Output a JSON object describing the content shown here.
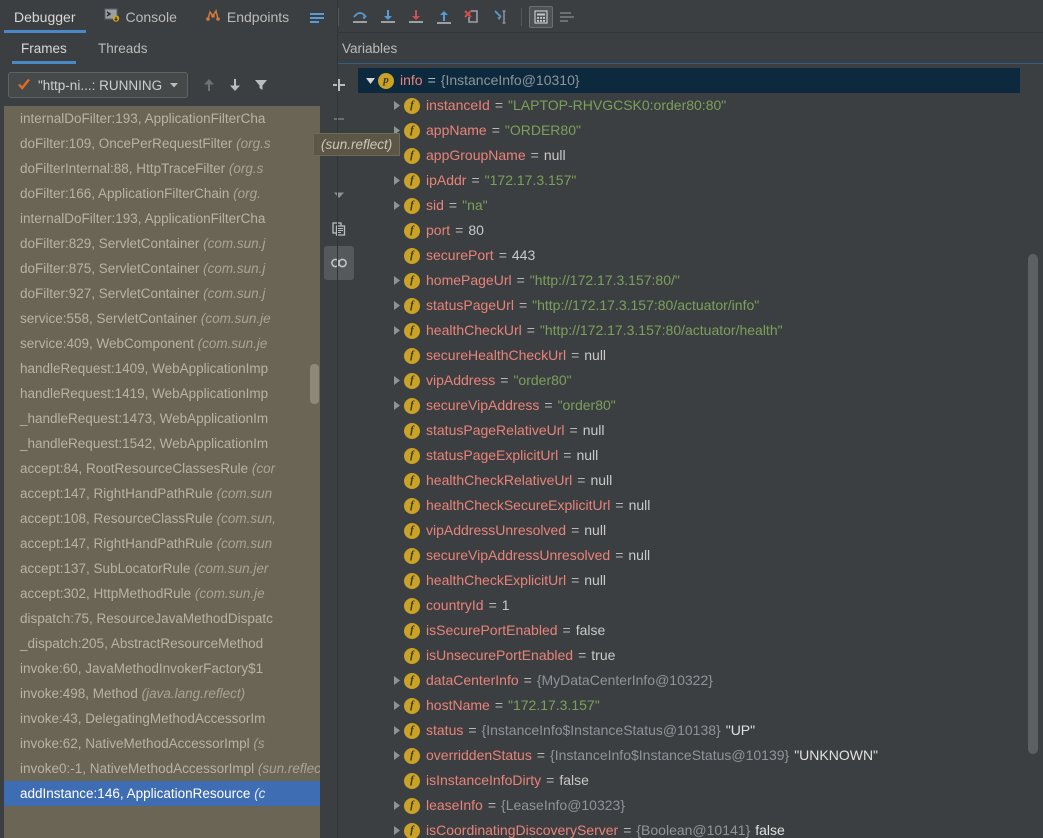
{
  "window": {
    "title": "Debugger",
    "bg_color": "#3c3f41",
    "accent_color": "#4a88c7"
  },
  "top_tabs": [
    {
      "label": "Debugger",
      "icon": "bug-icon",
      "active": true
    },
    {
      "label": "Console",
      "icon": "console-icon",
      "active": false
    },
    {
      "label": "Endpoints",
      "icon": "endpoints-icon",
      "active": false
    }
  ],
  "toolbar_icons": [
    {
      "name": "layout-lines-icon",
      "tooltip": "Layout"
    },
    {
      "name": "step-over-icon",
      "tooltip": "Step Over"
    },
    {
      "name": "step-into-icon",
      "tooltip": "Step Into"
    },
    {
      "name": "force-step-into-icon",
      "tooltip": "Force Step Into"
    },
    {
      "name": "step-out-icon",
      "tooltip": "Step Out"
    },
    {
      "name": "drop-frame-icon",
      "tooltip": "Drop Frame"
    },
    {
      "name": "run-to-cursor-icon",
      "tooltip": "Run to Cursor"
    },
    {
      "name": "evaluate-expression-icon",
      "tooltip": "Evaluate Expression"
    },
    {
      "name": "settings-lines-icon",
      "tooltip": "Settings"
    }
  ],
  "sub_tabs": [
    {
      "label": "Frames",
      "active": true
    },
    {
      "label": "Threads",
      "active": false
    }
  ],
  "variables_header": {
    "label": "Variables"
  },
  "frames_toolbar": {
    "thread_selector": {
      "label": "\"http-ni...: RUNNING",
      "status_icon": "check-icon",
      "chevron": "chevron-down-icon"
    },
    "buttons": [
      {
        "name": "move-up-icon",
        "label": "Up"
      },
      {
        "name": "move-down-icon",
        "label": "Down"
      },
      {
        "name": "filter-icon",
        "label": "Filter"
      }
    ]
  },
  "mid_toolbar": [
    {
      "name": "add-watch-icon",
      "glyph": "+",
      "pressed": false
    },
    {
      "name": "remove-watch-icon",
      "glyph": "–",
      "pressed": false
    },
    {
      "name": "dropdown-icon",
      "glyph": "chevron-down",
      "pressed": false
    },
    {
      "name": "copy-icon",
      "glyph": "copy",
      "pressed": false
    },
    {
      "name": "watches-icon",
      "glyph": "watches",
      "pressed": true
    }
  ],
  "frames": [
    {
      "method": "addInstance:146, ApplicationResource",
      "pkg": "(c",
      "selected": true
    },
    {
      "method": "invoke0:-1, NativeMethodAccessorImpl",
      "pkg": "(sun.reflect)",
      "selected": false
    },
    {
      "method": "invoke:62, NativeMethodAccessorImpl",
      "pkg": "(s",
      "selected": false
    },
    {
      "method": "invoke:43, DelegatingMethodAccessorIm",
      "pkg": "",
      "selected": false
    },
    {
      "method": "invoke:498, Method",
      "pkg": "(java.lang.reflect)",
      "selected": false
    },
    {
      "method": "invoke:60, JavaMethodInvokerFactory$1",
      "pkg": "",
      "selected": false
    },
    {
      "method": "_dispatch:205, AbstractResourceMethod",
      "pkg": "",
      "selected": false
    },
    {
      "method": "dispatch:75, ResourceJavaMethodDispatc",
      "pkg": "",
      "selected": false
    },
    {
      "method": "accept:302, HttpMethodRule",
      "pkg": "(com.sun.je",
      "selected": false
    },
    {
      "method": "accept:137, SubLocatorRule",
      "pkg": "(com.sun.jer",
      "selected": false
    },
    {
      "method": "accept:147, RightHandPathRule",
      "pkg": "(com.sun",
      "selected": false
    },
    {
      "method": "accept:108, ResourceClassRule",
      "pkg": "(com.sun,",
      "selected": false
    },
    {
      "method": "accept:147, RightHandPathRule",
      "pkg": "(com.sun",
      "selected": false
    },
    {
      "method": "accept:84, RootResourceClassesRule",
      "pkg": "(cor",
      "selected": false
    },
    {
      "method": "_handleRequest:1542, WebApplicationIm",
      "pkg": "",
      "selected": false
    },
    {
      "method": "_handleRequest:1473, WebApplicationIm",
      "pkg": "",
      "selected": false
    },
    {
      "method": "handleRequest:1419, WebApplicationImp",
      "pkg": "",
      "selected": false
    },
    {
      "method": "handleRequest:1409, WebApplicationImp",
      "pkg": "",
      "selected": false
    },
    {
      "method": "service:409, WebComponent",
      "pkg": "(com.sun.je",
      "selected": false
    },
    {
      "method": "service:558, ServletContainer",
      "pkg": "(com.sun.je",
      "selected": false
    },
    {
      "method": "doFilter:927, ServletContainer",
      "pkg": "(com.sun.j",
      "selected": false
    },
    {
      "method": "doFilter:875, ServletContainer",
      "pkg": "(com.sun.j",
      "selected": false
    },
    {
      "method": "doFilter:829, ServletContainer",
      "pkg": "(com.sun.j",
      "selected": false
    },
    {
      "method": "internalDoFilter:193, ApplicationFilterCha",
      "pkg": "",
      "selected": false
    },
    {
      "method": "doFilter:166, ApplicationFilterChain",
      "pkg": "(org.",
      "selected": false
    },
    {
      "method": "doFilterInternal:88, HttpTraceFilter",
      "pkg": "(org.s",
      "selected": false
    },
    {
      "method": "doFilter:109, OncePerRequestFilter",
      "pkg": "(org.s",
      "selected": false
    },
    {
      "method": "internalDoFilter:193, ApplicationFilterCha",
      "pkg": "",
      "selected": false
    }
  ],
  "tooltip": {
    "text": "(sun.reflect)"
  },
  "variables": [
    {
      "indent": 0,
      "twisty": "expanded",
      "icon": "p",
      "name": "info",
      "op": "=",
      "value": "{InstanceInfo@10310}",
      "vtype": "ref",
      "selected": true
    },
    {
      "indent": 1,
      "twisty": "collapsed",
      "icon": "f",
      "name": "instanceId",
      "op": "=",
      "value": "\"LAPTOP-RHVGCSK0:order80:80\"",
      "vtype": "str",
      "selected": false
    },
    {
      "indent": 1,
      "twisty": "collapsed",
      "icon": "f",
      "name": "appName",
      "op": "=",
      "value": "\"ORDER80\"",
      "vtype": "str",
      "selected": false
    },
    {
      "indent": 1,
      "twisty": "none",
      "icon": "f",
      "name": "appGroupName",
      "op": "=",
      "value": "null",
      "vtype": "null",
      "selected": false
    },
    {
      "indent": 1,
      "twisty": "collapsed",
      "icon": "f",
      "name": "ipAddr",
      "op": "=",
      "value": "\"172.17.3.157\"",
      "vtype": "str",
      "selected": false
    },
    {
      "indent": 1,
      "twisty": "collapsed",
      "icon": "f",
      "name": "sid",
      "op": "=",
      "value": "\"na\"",
      "vtype": "str",
      "selected": false
    },
    {
      "indent": 1,
      "twisty": "none",
      "icon": "f",
      "name": "port",
      "op": "=",
      "value": "80",
      "vtype": "num",
      "selected": false
    },
    {
      "indent": 1,
      "twisty": "none",
      "icon": "f",
      "name": "securePort",
      "op": "=",
      "value": "443",
      "vtype": "num",
      "selected": false
    },
    {
      "indent": 1,
      "twisty": "collapsed",
      "icon": "f",
      "name": "homePageUrl",
      "op": "=",
      "value": "\"http://172.17.3.157:80/\"",
      "vtype": "str",
      "selected": false
    },
    {
      "indent": 1,
      "twisty": "collapsed",
      "icon": "f",
      "name": "statusPageUrl",
      "op": "=",
      "value": "\"http://172.17.3.157:80/actuator/info\"",
      "vtype": "str",
      "selected": false
    },
    {
      "indent": 1,
      "twisty": "collapsed",
      "icon": "f",
      "name": "healthCheckUrl",
      "op": "=",
      "value": "\"http://172.17.3.157:80/actuator/health\"",
      "vtype": "str",
      "selected": false
    },
    {
      "indent": 1,
      "twisty": "none",
      "icon": "f",
      "name": "secureHealthCheckUrl",
      "op": "=",
      "value": "null",
      "vtype": "null",
      "selected": false
    },
    {
      "indent": 1,
      "twisty": "collapsed",
      "icon": "f",
      "name": "vipAddress",
      "op": "=",
      "value": "\"order80\"",
      "vtype": "str",
      "selected": false
    },
    {
      "indent": 1,
      "twisty": "collapsed",
      "icon": "f",
      "name": "secureVipAddress",
      "op": "=",
      "value": "\"order80\"",
      "vtype": "str",
      "selected": false
    },
    {
      "indent": 1,
      "twisty": "none",
      "icon": "f",
      "name": "statusPageRelativeUrl",
      "op": "=",
      "value": "null",
      "vtype": "null",
      "selected": false
    },
    {
      "indent": 1,
      "twisty": "none",
      "icon": "f",
      "name": "statusPageExplicitUrl",
      "op": "=",
      "value": "null",
      "vtype": "null",
      "selected": false
    },
    {
      "indent": 1,
      "twisty": "none",
      "icon": "f",
      "name": "healthCheckRelativeUrl",
      "op": "=",
      "value": "null",
      "vtype": "null",
      "selected": false
    },
    {
      "indent": 1,
      "twisty": "none",
      "icon": "f",
      "name": "healthCheckSecureExplicitUrl",
      "op": "=",
      "value": "null",
      "vtype": "null",
      "selected": false
    },
    {
      "indent": 1,
      "twisty": "none",
      "icon": "f",
      "name": "vipAddressUnresolved",
      "op": "=",
      "value": "null",
      "vtype": "null",
      "selected": false
    },
    {
      "indent": 1,
      "twisty": "none",
      "icon": "f",
      "name": "secureVipAddressUnresolved",
      "op": "=",
      "value": "null",
      "vtype": "null",
      "selected": false
    },
    {
      "indent": 1,
      "twisty": "none",
      "icon": "f",
      "name": "healthCheckExplicitUrl",
      "op": "=",
      "value": "null",
      "vtype": "null",
      "selected": false
    },
    {
      "indent": 1,
      "twisty": "none",
      "icon": "f",
      "name": "countryId",
      "op": "=",
      "value": "1",
      "vtype": "num",
      "selected": false
    },
    {
      "indent": 1,
      "twisty": "none",
      "icon": "f",
      "name": "isSecurePortEnabled",
      "op": "=",
      "value": "false",
      "vtype": "num",
      "selected": false
    },
    {
      "indent": 1,
      "twisty": "none",
      "icon": "f",
      "name": "isUnsecurePortEnabled",
      "op": "=",
      "value": "true",
      "vtype": "num",
      "selected": false
    },
    {
      "indent": 1,
      "twisty": "collapsed",
      "icon": "f",
      "name": "dataCenterInfo",
      "op": "=",
      "value": "{MyDataCenterInfo@10322}",
      "vtype": "ref",
      "selected": false
    },
    {
      "indent": 1,
      "twisty": "collapsed",
      "icon": "f",
      "name": "hostName",
      "op": "=",
      "value": "\"172.17.3.157\"",
      "vtype": "str",
      "selected": false
    },
    {
      "indent": 1,
      "twisty": "collapsed",
      "icon": "f",
      "name": "status",
      "op": "=",
      "value": "{InstanceInfo$InstanceStatus@10138}",
      "vtype": "ref",
      "extra": "\"UP\"",
      "selected": false
    },
    {
      "indent": 1,
      "twisty": "collapsed",
      "icon": "f",
      "name": "overriddenStatus",
      "op": "=",
      "value": "{InstanceInfo$InstanceStatus@10139}",
      "vtype": "ref",
      "extra": "\"UNKNOWN\"",
      "selected": false
    },
    {
      "indent": 1,
      "twisty": "none",
      "icon": "f",
      "name": "isInstanceInfoDirty",
      "op": "=",
      "value": "false",
      "vtype": "num",
      "selected": false
    },
    {
      "indent": 1,
      "twisty": "collapsed",
      "icon": "f",
      "name": "leaseInfo",
      "op": "=",
      "value": "{LeaseInfo@10323}",
      "vtype": "ref",
      "selected": false
    },
    {
      "indent": 1,
      "twisty": "collapsed",
      "icon": "f",
      "name": "isCoordinatingDiscoveryServer",
      "op": "=",
      "value": "{Boolean@10141}",
      "vtype": "ref",
      "extra": "false",
      "selected": false
    }
  ],
  "colors": {
    "panel_bg": "#3c3f41",
    "frames_bg": "#6b6555",
    "frame_selected": "#3f6db3",
    "var_selected": "#0d293e",
    "var_name": "#e9837a",
    "var_string": "#7ba05b",
    "var_ref": "#8e9599",
    "icon_gold": "#c9a227",
    "tab_underline": "#4a88c7"
  }
}
